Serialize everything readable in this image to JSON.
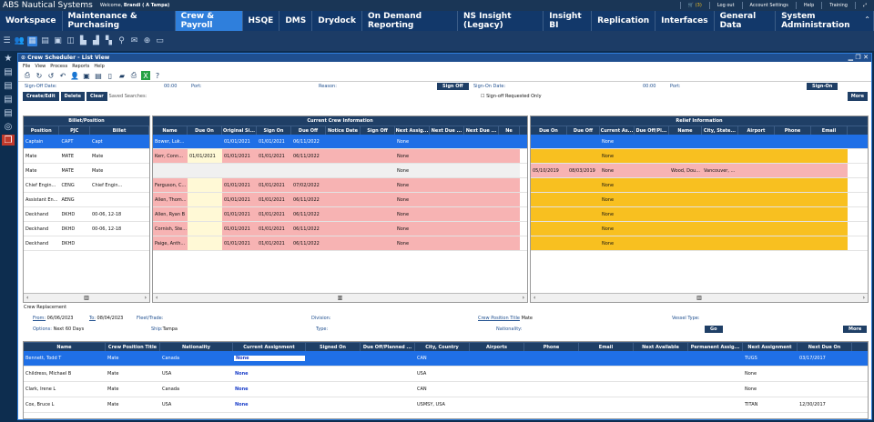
{
  "topbar": {
    "brand": "ABS Nautical Systems",
    "welcome": "Welcome, ",
    "welcome_user": "Brandi ( A Tampa)",
    "cart": "(3)",
    "logout": "Log out",
    "settings": "Account Settings",
    "help": "Help",
    "training": "Training"
  },
  "menu": [
    "Workspace",
    "Maintenance & Purchasing",
    "Crew & Payroll",
    "HSQE",
    "DMS",
    "Drydock",
    "On Demand Reporting",
    "NS Insight (Legacy)",
    "Insight BI",
    "Replication",
    "Interfaces",
    "General Data",
    "System Administration"
  ],
  "window": {
    "title": "Crew Scheduler - List View",
    "menu": [
      "File",
      "View",
      "Process",
      "Reports",
      "Help"
    ]
  },
  "signrow": {
    "signoff_label": "Sign-Off Date:",
    "time1": "00:00",
    "port1": "Port:",
    "reason": "Reason:",
    "signoff_btn": "Sign Off",
    "signon_label": "Sign-On Date:",
    "time2": "00:00",
    "port2": "Port:",
    "signon_btn": "Sign-On"
  },
  "actions": {
    "create": "Create/Edit",
    "delete": "Delete",
    "clear": "Clear",
    "saved": "Saved Searches:",
    "requested": "Sign-off Requested Only",
    "more": "More"
  },
  "billet": {
    "title": "Billet/Position",
    "cols": [
      "Position",
      "PJC",
      "Billet"
    ],
    "rows": [
      [
        "Captain",
        "CAPT",
        "Capt"
      ],
      [
        "Mate",
        "MATE",
        "Mate"
      ],
      [
        "Mate",
        "MATE",
        "Mate"
      ],
      [
        "Chief Engin...",
        "CENG",
        "Chief Engin..."
      ],
      [
        "Assistant En...",
        "AENG",
        ""
      ],
      [
        "Deckhand",
        "DKHD",
        "00-06, 12-18"
      ],
      [
        "Deckhand",
        "DKHD",
        "00-06, 12-18"
      ],
      [
        "Deckhand",
        "DKHD",
        ""
      ]
    ]
  },
  "crew": {
    "title": "Current Crew Information",
    "cols": [
      "Name",
      "Due On",
      "Original Si...",
      "Sign On",
      "Due Off",
      "Notice Date",
      "Sign Off",
      "Next Assig...",
      "Next Due ...",
      "Next Due ...",
      "Ne"
    ],
    "rows": [
      [
        "Bower, Luk...",
        "",
        "01/01/2021",
        "01/01/2021",
        "06/11/2022",
        "",
        "",
        "None"
      ],
      [
        "Kerr, Conn...",
        "01/01/2021",
        "01/01/2021",
        "01/01/2021",
        "06/11/2022",
        "",
        "",
        "None"
      ],
      [
        "",
        "",
        "",
        "",
        "",
        "",
        "",
        "None"
      ],
      [
        "Ferguson, C...",
        "",
        "01/01/2021",
        "01/01/2021",
        "07/02/2022",
        "",
        "",
        "None"
      ],
      [
        "Allen, Thom...",
        "",
        "01/01/2021",
        "01/01/2021",
        "06/11/2022",
        "",
        "",
        "None"
      ],
      [
        "Allen, Ryan B",
        "",
        "01/01/2021",
        "01/01/2021",
        "06/11/2022",
        "",
        "",
        "None"
      ],
      [
        "Cornish, Ste...",
        "",
        "01/01/2021",
        "01/01/2021",
        "06/11/2022",
        "",
        "",
        "None"
      ],
      [
        "Paige, Anth...",
        "",
        "01/01/2021",
        "01/01/2021",
        "06/11/2022",
        "",
        "",
        "None"
      ]
    ]
  },
  "relief": {
    "title": "Relief Information",
    "cols": [
      "Due On",
      "Due Off",
      "Current As...",
      "Due Off/Pl...",
      "Name",
      "City, State...",
      "Airport",
      "Phone",
      "Email"
    ],
    "rows": [
      [
        "",
        "",
        "None",
        "",
        "",
        "",
        "",
        "",
        ""
      ],
      [
        "",
        "",
        "None",
        "",
        "",
        "",
        "",
        "",
        ""
      ],
      [
        "05/10/2019",
        "08/03/2019",
        "None",
        "",
        "Wood, Dou...",
        "Vancouver, ...",
        "",
        "",
        ""
      ],
      [
        "",
        "",
        "None",
        "",
        "",
        "",
        "",
        "",
        ""
      ],
      [
        "",
        "",
        "None",
        "",
        "",
        "",
        "",
        "",
        ""
      ],
      [
        "",
        "",
        "None",
        "",
        "",
        "",
        "",
        "",
        ""
      ],
      [
        "",
        "",
        "None",
        "",
        "",
        "",
        "",
        "",
        ""
      ],
      [
        "",
        "",
        "None",
        "",
        "",
        "",
        "",
        "",
        ""
      ]
    ]
  },
  "replacement": {
    "section": "Crew Replacement",
    "from_label": "From:",
    "from": "06/06/2023",
    "to_label": "To:",
    "to": "08/04/2023",
    "fleet": "Fleet/Trade:",
    "division": "Division:",
    "cpt_label": "Crew Position Title",
    "cpt": "Mate",
    "vessel": "Vessel Type:",
    "options_label": "Options:",
    "options": "Next 60 Days",
    "ship_label": "Ship:",
    "ship": "Tampa",
    "type": "Type:",
    "nationality": "Nationality:",
    "go": "Go",
    "more": "More",
    "cols": [
      "Name",
      "Crew Position Title",
      "Nationality",
      "Current Assignment",
      "Signed On",
      "Due Off/Planned ...",
      "City, Country",
      "Airports",
      "Phone",
      "Email",
      "Next Available",
      "Permanent Assig...",
      "Next Assignment",
      "Next Due On"
    ],
    "rows": [
      [
        "Bennett, Todd T",
        "Mate",
        "Canada",
        "None",
        "",
        "",
        "CAN",
        "",
        "",
        "",
        "",
        "",
        "TUGS",
        "03/17/2017"
      ],
      [
        "Childress, Michael B",
        "Mate",
        "USA",
        "None",
        "",
        "",
        "USA",
        "",
        "",
        "",
        "",
        "",
        "None",
        ""
      ],
      [
        "Clark, Irene L",
        "Mate",
        "Canada",
        "None",
        "",
        "",
        "CAN",
        "",
        "",
        "",
        "",
        "",
        "None",
        ""
      ],
      [
        "Cox, Bruce L",
        "Mate",
        "USA",
        "None",
        "",
        "",
        "USMSY, USA",
        "",
        "",
        "",
        "",
        "",
        "TITAN",
        "12/30/2017"
      ]
    ]
  }
}
